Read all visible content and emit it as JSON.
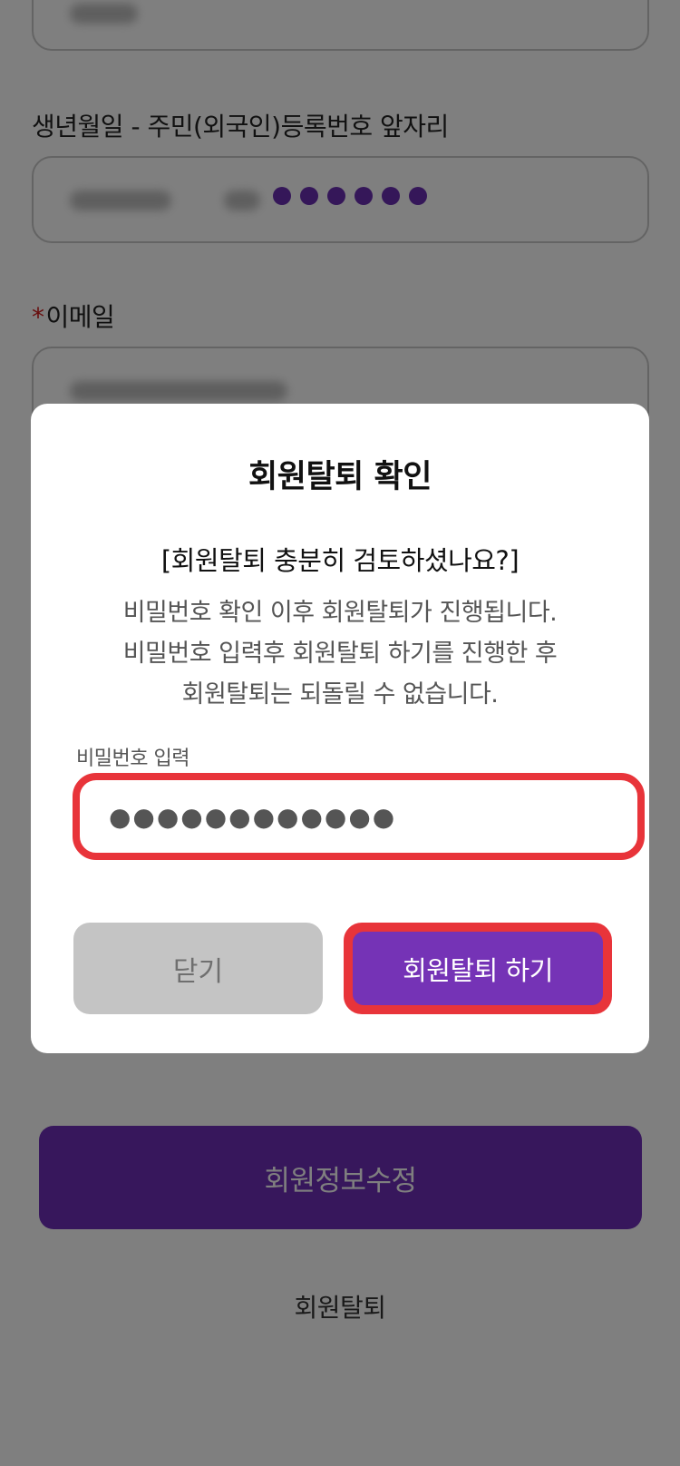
{
  "form": {
    "birth_label": "생년월일 - 주민(외국인)등록번호 앞자리",
    "email_required_mark": "*",
    "email_label": "이메일",
    "edit_button_label": "회원정보수정",
    "withdraw_link_label": "회원탈퇴"
  },
  "dialog": {
    "title": "회원탈퇴 확인",
    "subtitle": "[회원탈퇴 충분히 검토하셨나요?]",
    "message_lines": [
      "비밀번호 확인 이후 회원탈퇴가 진행됩니다.",
      "비밀번호 입력후 회원탈퇴 하기를 진행한 후",
      "회원탈퇴는 되돌릴 수 없습니다."
    ],
    "password_label": "비밀번호 입력",
    "password_value": "●●●●●●●●●●●●",
    "close_button_label": "닫기",
    "confirm_button_label": "회원탈퇴 하기"
  },
  "colors": {
    "accent": "#7533b6",
    "highlight": "#e8343a",
    "disabled": "#c4c4c4"
  }
}
